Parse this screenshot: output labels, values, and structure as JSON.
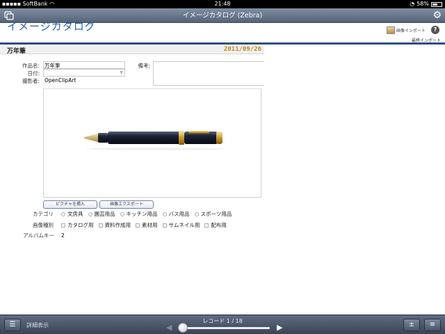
{
  "status_bar": {
    "carrier": "SoftBank",
    "time": "21:48",
    "battery": "58%",
    "battery_level": 0.58
  },
  "title_bar": {
    "title": "イメージカタログ (Zebra)"
  },
  "header": {
    "layout_title": "イメージカタログ",
    "image_import_label": "画像インポート",
    "help_label": "?",
    "last_import_label": "最終インポート"
  },
  "record": {
    "name": "万年筆",
    "date": "2011/09/26",
    "fields": {
      "title_label": "作品名:",
      "title_value": "万年筆",
      "date_label": "日付:",
      "photographer_label": "撮影者:",
      "photographer_value": "OpenClipArt",
      "notes_label": "備考:"
    }
  },
  "buttons": {
    "insert_picture": "ピクチャを挿入",
    "export_image": "画像エクスポート"
  },
  "category": {
    "label": "カテゴリ",
    "options": [
      "文房具",
      "園芸用品",
      "キッチン用品",
      "バス用品",
      "スポーツ用品"
    ]
  },
  "image_type": {
    "label": "画像種別",
    "options": [
      "カタログ用",
      "資料作成用",
      "素材用",
      "サムネイル用",
      "配布用"
    ]
  },
  "album_key": {
    "label": "アルバムキー",
    "value": "2"
  },
  "bottom_bar": {
    "view_label": "詳細表示",
    "record_counter": "レコード 1 / 18",
    "current_record": 1,
    "total_records": 18
  },
  "colors": {
    "accent_blue": "#2a5fa8",
    "date_gold": "#c08a14",
    "header_rule": "#2f4e80"
  }
}
